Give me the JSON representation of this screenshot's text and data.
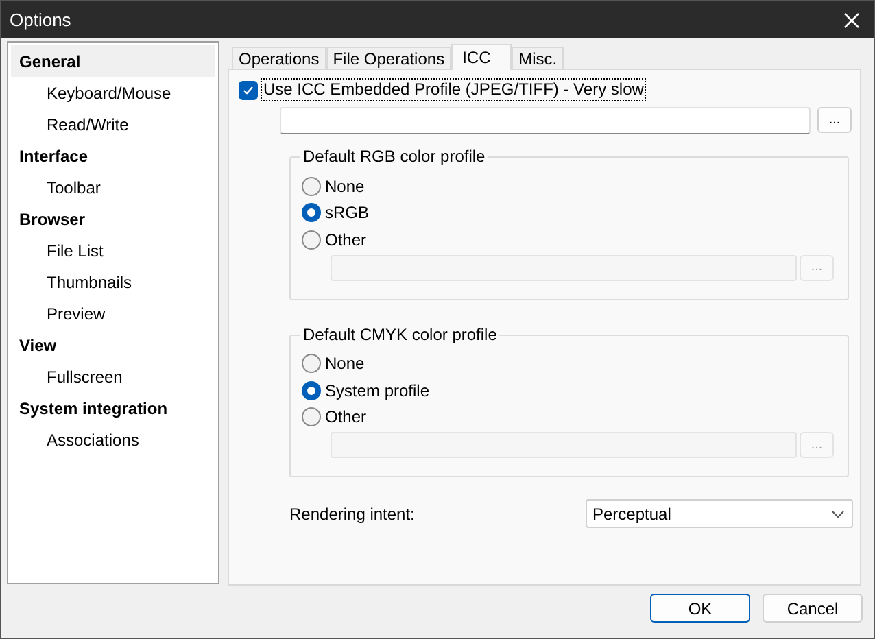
{
  "window": {
    "title": "Options"
  },
  "sidebar": {
    "items": [
      {
        "label": "General",
        "selected": true,
        "children": [
          {
            "label": "Keyboard/Mouse",
            "selected": false
          },
          {
            "label": "Read/Write",
            "selected": false
          }
        ]
      },
      {
        "label": "Interface",
        "selected": false,
        "children": [
          {
            "label": "Toolbar",
            "selected": false
          }
        ]
      },
      {
        "label": "Browser",
        "selected": false,
        "children": [
          {
            "label": "File List",
            "selected": false
          },
          {
            "label": "Thumbnails",
            "selected": false
          },
          {
            "label": "Preview",
            "selected": false
          }
        ]
      },
      {
        "label": "View",
        "selected": false,
        "children": [
          {
            "label": "Fullscreen",
            "selected": false
          }
        ]
      },
      {
        "label": "System integration",
        "selected": false,
        "children": [
          {
            "label": "Associations",
            "selected": false
          }
        ]
      }
    ]
  },
  "tabs": [
    {
      "label": "Operations",
      "selected": false
    },
    {
      "label": "File Operations",
      "selected": false
    },
    {
      "label": "ICC",
      "selected": true
    },
    {
      "label": "Misc.",
      "selected": false
    }
  ],
  "icc": {
    "checkbox": {
      "label": "Use ICC Embedded Profile (JPEG/TIFF) - Very slow",
      "checked": true
    },
    "browse_button": "...",
    "groups": [
      {
        "title": "Default RGB color profile",
        "options": [
          {
            "label": "None",
            "selected": false
          },
          {
            "label": "sRGB",
            "selected": true
          },
          {
            "label": "Other",
            "selected": false
          }
        ],
        "browse_button": "...",
        "disabled": true
      },
      {
        "title": "Default CMYK color profile",
        "options": [
          {
            "label": "None",
            "selected": false
          },
          {
            "label": "System profile",
            "selected": true
          },
          {
            "label": "Other",
            "selected": false
          }
        ],
        "browse_button": "...",
        "disabled": true
      }
    ],
    "rendering_intent": {
      "label": "Rendering intent:",
      "value": "Perceptual"
    }
  },
  "buttons": [
    {
      "label": "OK",
      "default": true
    },
    {
      "label": "Cancel",
      "default": false
    }
  ]
}
